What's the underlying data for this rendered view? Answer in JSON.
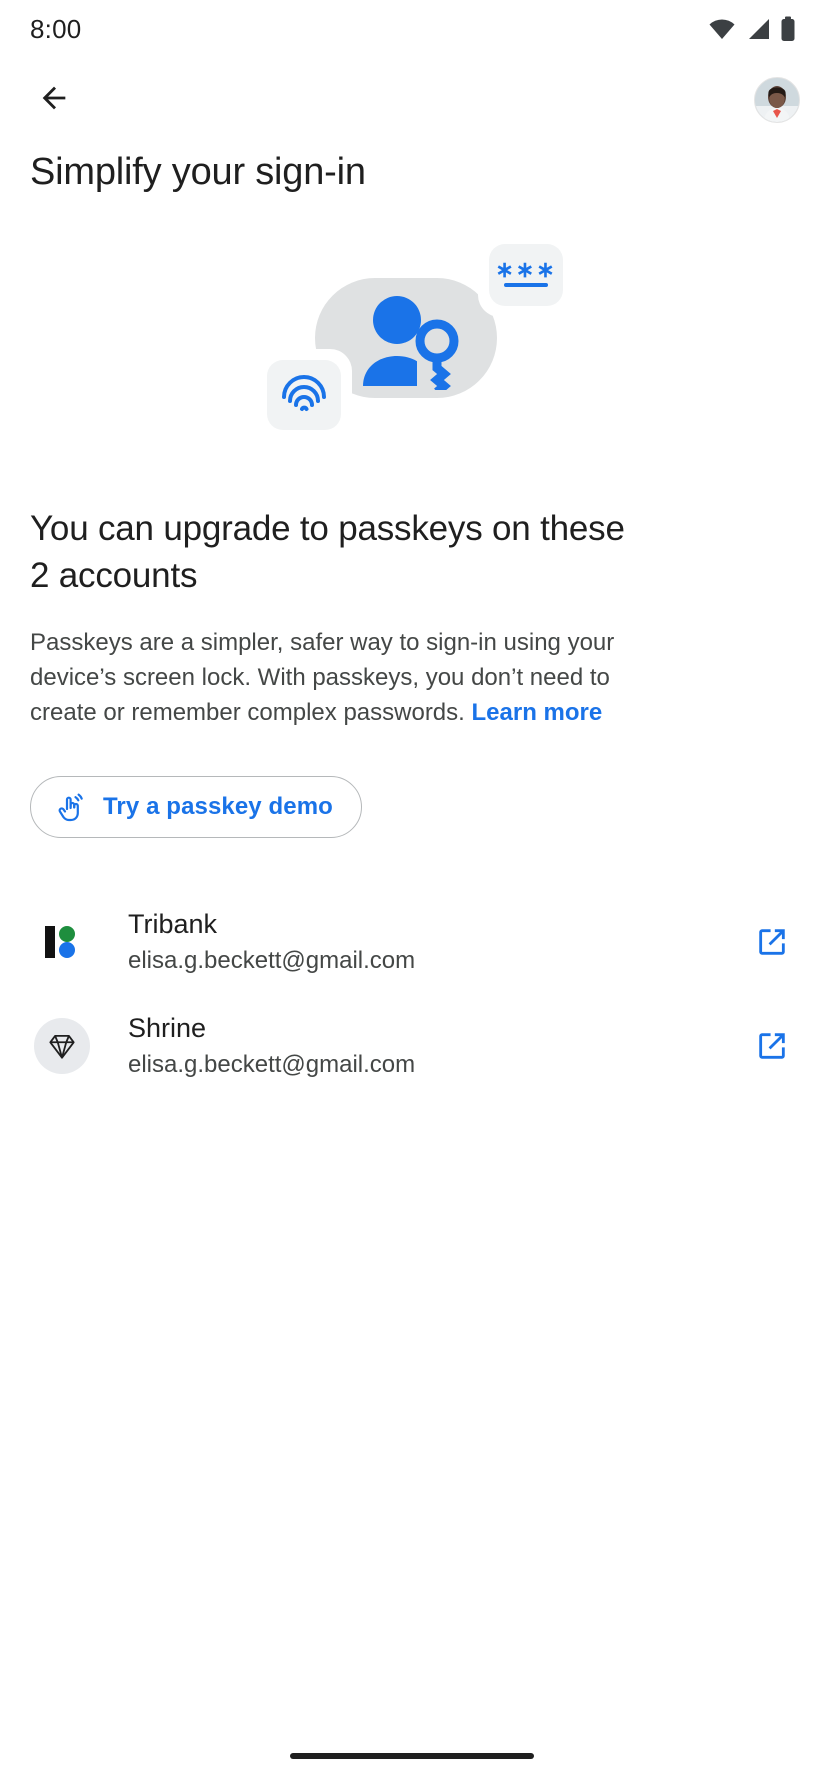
{
  "status_bar": {
    "time": "8:00",
    "icons": [
      "wifi-icon",
      "cell-signal-icon",
      "battery-icon"
    ]
  },
  "app_bar": {
    "back_icon": "back-arrow-icon",
    "avatar_label": "Account avatar"
  },
  "page_title": "Simplify your sign-in",
  "illustration": {
    "name": "passkey-illustration",
    "password_dots": "∗∗∗",
    "parts": [
      "person-key-icon",
      "password-field-card",
      "fingerprint-card"
    ],
    "blob_color": "#dfe1e2",
    "accent_color": "#1a73e8",
    "card_color": "#f1f3f4"
  },
  "headline": "You can upgrade to passkeys on these 2 accounts",
  "body": {
    "text": "Passkeys are a simpler, safer way to sign-in using your device’s screen lock. With passkeys, you don’t need to create or remember complex passwords. ",
    "link_label": "Learn more",
    "link_color": "#1a73e8"
  },
  "demo_button": {
    "label": "Try a passkey demo",
    "icon": "touch-gesture-icon",
    "text_color": "#1a73e8",
    "border_color": "#b5b8ba"
  },
  "accounts": [
    {
      "name": "Tribank",
      "email": "elisa.g.beckett@gmail.com",
      "logo": "tribank-logo-icon",
      "action_icon": "open-in-new-icon"
    },
    {
      "name": "Shrine",
      "email": "elisa.g.beckett@gmail.com",
      "logo": "shrine-diamond-icon",
      "action_icon": "open-in-new-icon"
    }
  ],
  "nav_bar": {
    "handle": "home-gesture-handle"
  },
  "theme": {
    "background": "#ffffff",
    "text_primary": "#1f1f1f",
    "text_secondary": "#444746",
    "accent_blue": "#1a73e8",
    "logo_green": "#1e8e3e"
  }
}
